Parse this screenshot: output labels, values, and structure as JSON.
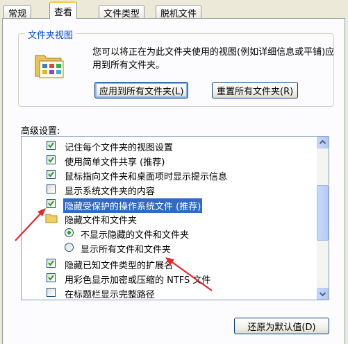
{
  "tabs": [
    {
      "label": "常规",
      "active": false
    },
    {
      "label": "查看",
      "active": true
    },
    {
      "label": "文件类型",
      "active": false
    },
    {
      "label": "脱机文件",
      "active": false
    }
  ],
  "folder_views": {
    "title": "文件夹视图",
    "description": "您可以将正在为此文件夹使用的视图(例如详细信息或平铺)应用到所有文件夹。",
    "apply_all_button": "应用到所有文件夹(L)",
    "reset_all_button": "重置所有文件夹(R)"
  },
  "advanced": {
    "label": "高级设置:",
    "items": [
      {
        "type": "checkbox",
        "checked": true,
        "label": "记住每个文件夹的视图设置"
      },
      {
        "type": "checkbox",
        "checked": true,
        "label": "使用简单文件共享 (推荐)"
      },
      {
        "type": "checkbox",
        "checked": true,
        "label": "鼠标指向文件夹和桌面项时显示提示信息"
      },
      {
        "type": "checkbox",
        "checked": false,
        "label": "显示系统文件夹的内容"
      },
      {
        "type": "checkbox",
        "checked": true,
        "label": "隐藏受保护的操作系统文件 (推荐)",
        "selected": true
      },
      {
        "type": "folder",
        "label": "隐藏文件和文件夹"
      },
      {
        "type": "radio",
        "checked": true,
        "label": "不显示隐藏的文件和文件夹"
      },
      {
        "type": "radio",
        "checked": false,
        "label": "显示所有文件和文件夹"
      },
      {
        "type": "checkbox",
        "checked": true,
        "label": "隐藏已知文件类型的扩展名"
      },
      {
        "type": "checkbox",
        "checked": true,
        "label": "用彩色显示加密或压缩的 NTFS 文件"
      },
      {
        "type": "checkbox",
        "checked": false,
        "label": "在标题栏显示完整路径"
      }
    ]
  },
  "restore_defaults_button": "还原为默认值(D)",
  "colors": {
    "selection": "#316ac5",
    "arrow": "#e8262b",
    "tab_accent": "#ffc83c"
  }
}
